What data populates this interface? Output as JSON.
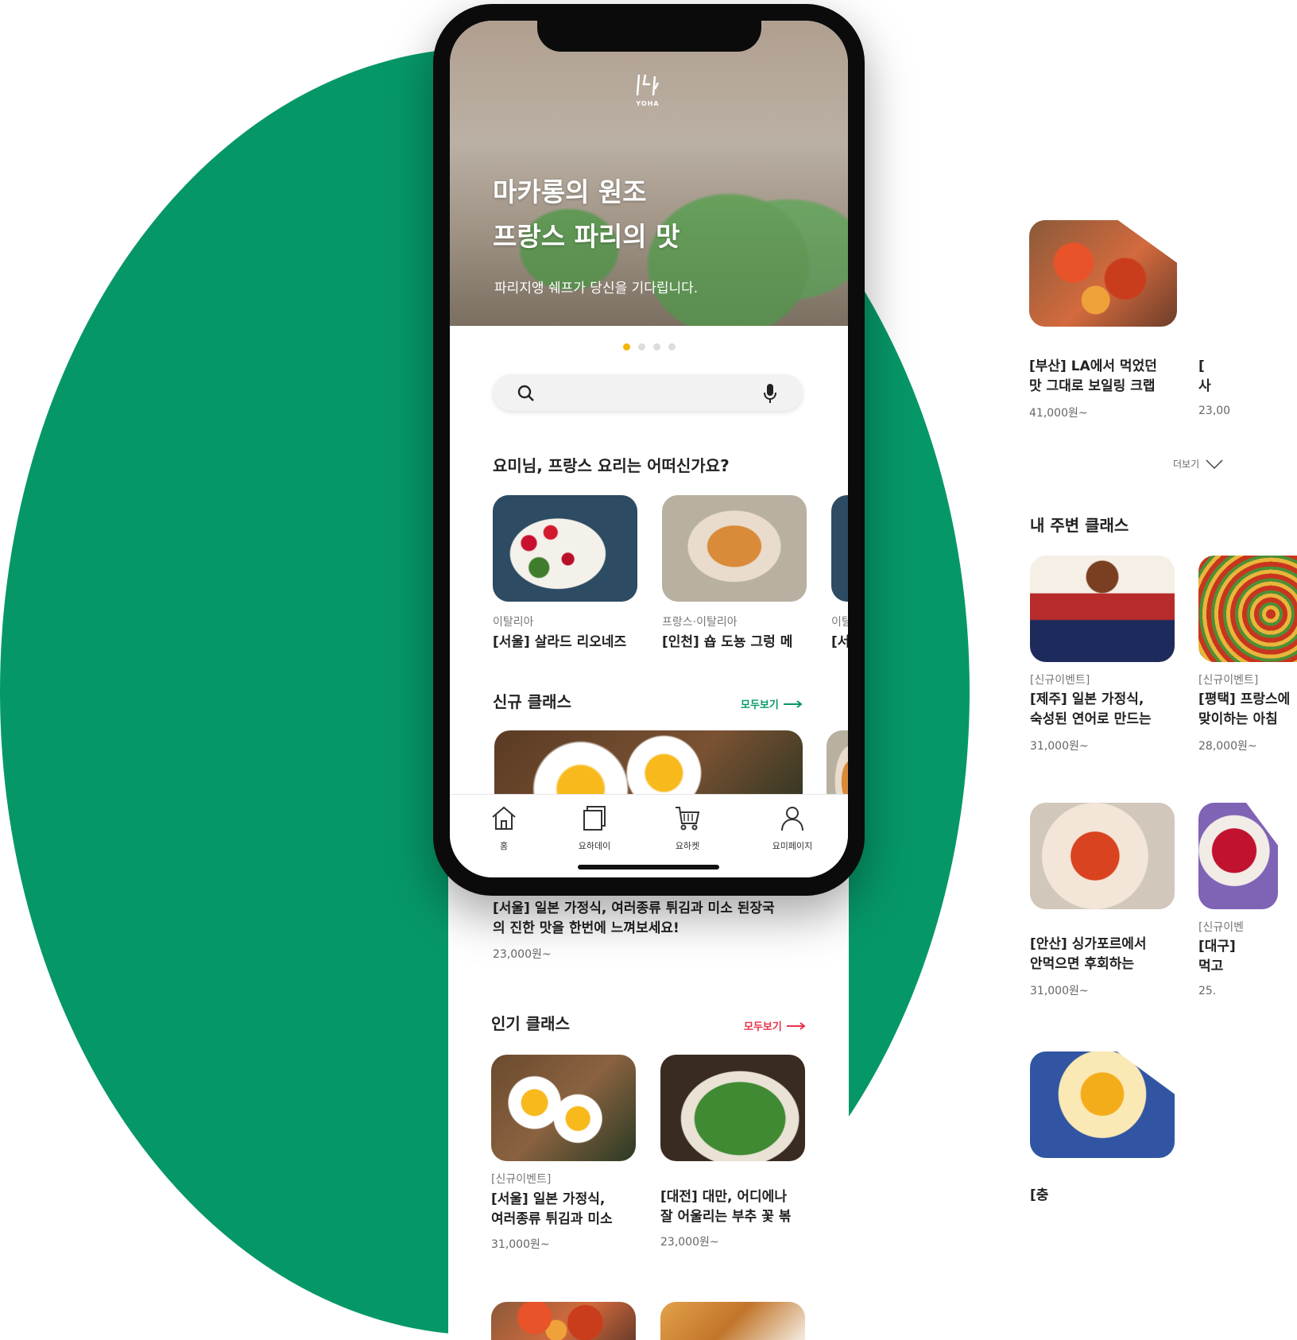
{
  "brand": {
    "logo_text": "YOHA"
  },
  "hero": {
    "title_line1": "마카롱의 원조",
    "title_line2": "프랑스 파리의 맛",
    "subtitle": "파리지앵 쉐프가 당신을 기다립니다.",
    "active_slide": 1,
    "slide_count": 4
  },
  "recommend": {
    "heading": "요미님, 프랑스 요리는 어떠신가요?",
    "items": [
      {
        "category": "이탈리아",
        "title": "[서울] 살라드 리오네즈"
      },
      {
        "category": "프랑스·이탈리아",
        "title": "[인천] 숍 도뇽 그렁 메"
      },
      {
        "category": "이탈",
        "title": "[서"
      }
    ]
  },
  "new_classes": {
    "heading": "신규 클래스",
    "see_all": "모두보기",
    "featured_title_line1": "[서울] 일본 가정식, 여러종류 튀김과 미소 된장국",
    "featured_title_line2": "의 진한 맛을 한번에 느껴보세요!",
    "featured_price": "23,000원~"
  },
  "popular": {
    "heading": "인기 클래스",
    "see_all": "모두보기",
    "items": [
      {
        "category": "[신규이벤트]",
        "title_line1": "[서울] 일본 가정식,",
        "title_line2": "여러종류 튀김과 미소",
        "price": "31,000원~"
      },
      {
        "category": "",
        "title_line1": "[대전] 대만, 어디에나",
        "title_line2": "잘 어울리는 부추 꽃 볶",
        "price": "23,000원~"
      }
    ]
  },
  "tabbar": {
    "home": "홈",
    "yohaday": "요하데이",
    "yohacart": "요하켓",
    "mypage": "요미페이지"
  },
  "right": {
    "top_items": [
      {
        "title_line1": "[부산] LA에서 먹었던",
        "title_line2": "맛 그대로 보일링 크랩",
        "price": "41,000원~"
      },
      {
        "title_line1": "[",
        "title_line2": "사",
        "price": "23,00"
      }
    ],
    "more": "더보기",
    "nearby_heading": "내 주변 클래스",
    "nearby_items": [
      {
        "category": "[신규이벤트]",
        "title_line1": "[제주] 일본 가정식,",
        "title_line2": "숙성된 연어로 만드는",
        "price": "31,000원~"
      },
      {
        "category": "[신규이벤트]",
        "title_line1": "[평택] 프랑스에",
        "title_line2": "맞이하는 아침 ",
        "price": "28,000원~"
      },
      {
        "category": "",
        "title_line1": "[안산] 싱가포르에서",
        "title_line2": "안먹으면 후회하는",
        "price": "31,000원~"
      },
      {
        "category": "[신규이벤",
        "title_line1": "[대구] ",
        "title_line2": "먹고 ",
        "price": "25."
      },
      {
        "category": "",
        "title_line1": "[충",
        "title_line2": "",
        "price": ""
      }
    ]
  },
  "colors": {
    "green": "#069768",
    "accent_yellow": "#f5b400",
    "accent_red": "#e8344a"
  }
}
